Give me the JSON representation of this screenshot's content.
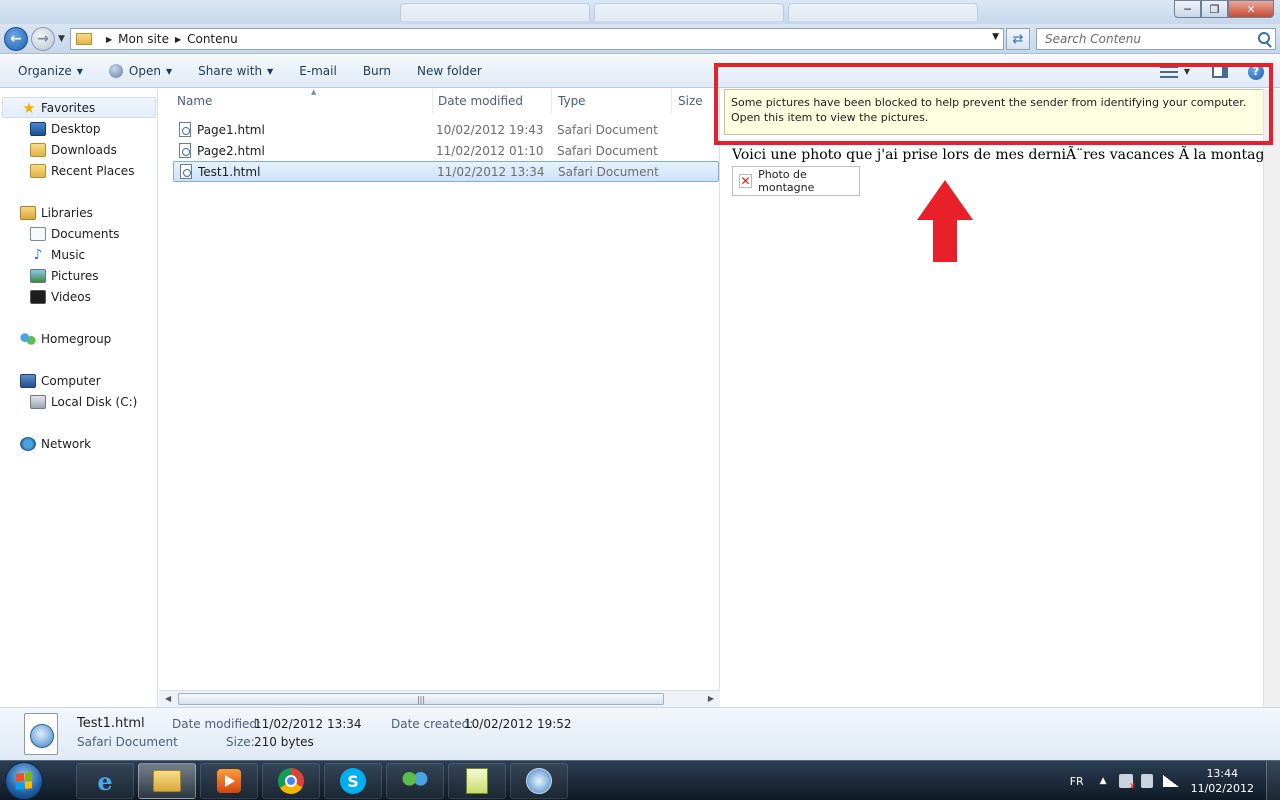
{
  "addressbar": {
    "breadcrumbs": [
      "Mon site",
      "Contenu"
    ],
    "search_placeholder": "Search Contenu"
  },
  "toolbar": {
    "organize": "Organize",
    "open": "Open",
    "share_with": "Share with",
    "email": "E-mail",
    "burn": "Burn",
    "new_folder": "New folder"
  },
  "nav": {
    "favorites": "Favorites",
    "desktop": "Desktop",
    "downloads": "Downloads",
    "recent_places": "Recent Places",
    "libraries": "Libraries",
    "documents": "Documents",
    "music": "Music",
    "pictures": "Pictures",
    "videos": "Videos",
    "homegroup": "Homegroup",
    "computer": "Computer",
    "local_disk": "Local Disk (C:)",
    "network": "Network"
  },
  "filelist": {
    "columns": {
      "name": "Name",
      "date_modified": "Date modified",
      "type": "Type",
      "size": "Size"
    },
    "files": [
      {
        "name": "Page1.html",
        "date": "10/02/2012 19:43",
        "type": "Safari Document"
      },
      {
        "name": "Page2.html",
        "date": "11/02/2012 01:10",
        "type": "Safari Document"
      },
      {
        "name": "Test1.html",
        "date": "11/02/2012 13:34",
        "type": "Safari Document",
        "selected": true
      }
    ]
  },
  "preview": {
    "infobar": "Some pictures have been blocked to help prevent the sender from identifying your computer. Open this item to view the pictures.",
    "body_text": "Voici une photo que j'ai prise lors de mes derniÃ¨res vacances Ã  la montagne :",
    "broken_image_alt": "Photo de montagne"
  },
  "details": {
    "filename": "Test1.html",
    "filetype": "Safari Document",
    "date_modified_label": "Date modified:",
    "date_modified_value": "11/02/2012 13:34",
    "date_created_label": "Date created:",
    "date_created_value": "10/02/2012 19:52",
    "size_label": "Size:",
    "size_value": "210 bytes"
  },
  "taskbar": {
    "language": "FR",
    "time": "13:44",
    "date": "11/02/2012"
  },
  "colors": {
    "highlight": "#e8202a",
    "infobar_bg": "#ffffe1",
    "selection": "#cde3f9"
  }
}
